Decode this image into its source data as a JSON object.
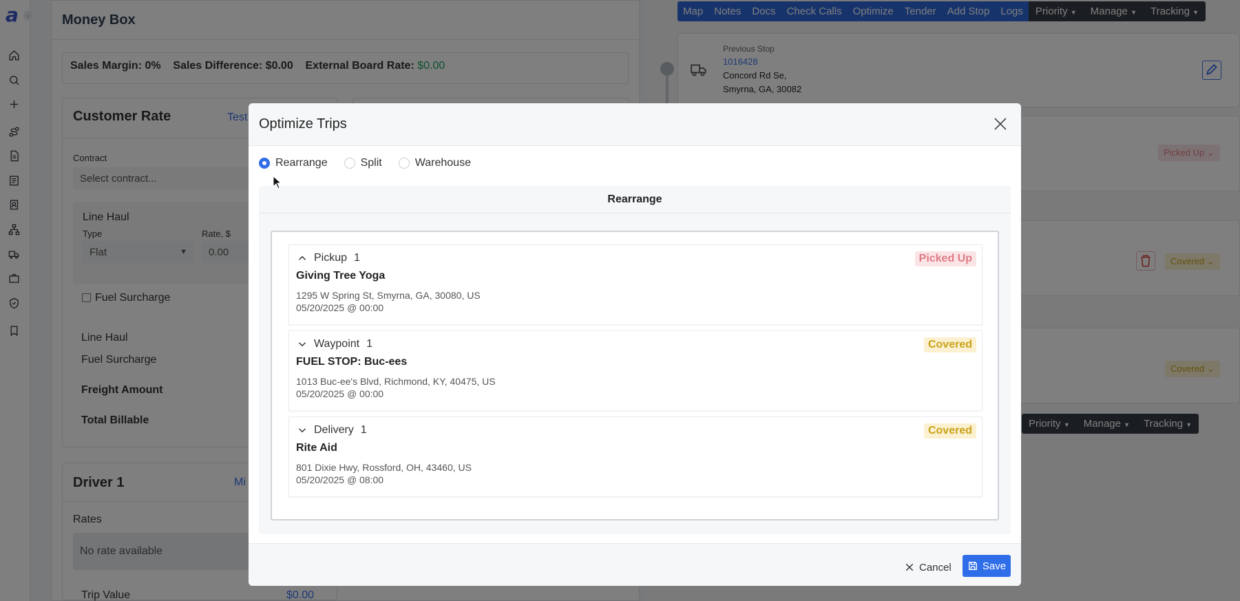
{
  "app": {
    "logo": "a"
  },
  "sidebar": {
    "icons": [
      "home-icon",
      "search-icon",
      "plus-icon",
      "route-icon",
      "document-icon",
      "list-icon",
      "contact-icon",
      "org-chart-icon",
      "truck-icon",
      "briefcase-icon",
      "shield-icon",
      "bookmark-icon"
    ]
  },
  "money_box": {
    "title": "Money Box",
    "sales_margin_label": "Sales Margin: 0%",
    "sales_difference_label": "Sales Difference: $0.00",
    "external_board_rate_label": "External Board Rate:",
    "external_board_rate_value": "$0.00"
  },
  "customer_rate": {
    "title": "Customer Rate",
    "link": "Test",
    "contract_label": "Contract",
    "contract_placeholder": "Select contract...",
    "line_haul_heading": "Line Haul",
    "type_label": "Type",
    "type_value": "Flat",
    "rate_label": "Rate, $",
    "rate_value": "0.00",
    "fuel_surcharge_checkbox": "Fuel Surcharge",
    "summary": [
      "Line Haul",
      "Fuel Surcharge",
      "Freight Amount",
      "Total Billable"
    ]
  },
  "driver": {
    "title": "Driver 1",
    "link": "Mi",
    "rates_label": "Rates",
    "no_rate": "No rate available",
    "trip_value_label": "Trip Value",
    "trip_value": "$0.00"
  },
  "topnav": {
    "buttons": [
      "Map",
      "Notes",
      "Docs",
      "Check Calls",
      "Optimize",
      "Tender",
      "Add Stop",
      "Logs"
    ],
    "dropdowns": [
      "Priority",
      "Manage",
      "Tracking"
    ]
  },
  "previous_stop": {
    "label": "Previous Stop",
    "id": "1016428",
    "line1": "Concord Rd Se,",
    "line2": "Smyrna, GA, 30082"
  },
  "right_badges": {
    "picked_up": "Picked Up",
    "covered": "Covered"
  },
  "modal": {
    "title": "Optimize Trips",
    "options": [
      {
        "label": "Rearrange",
        "selected": true
      },
      {
        "label": "Split",
        "selected": false
      },
      {
        "label": "Warehouse",
        "selected": false
      }
    ],
    "section_title": "Rearrange",
    "stops": [
      {
        "type": "Pickup",
        "num": "1",
        "expanded": true,
        "name": "Giving Tree Yoga",
        "address": "1295 W Spring St, Smyrna, GA, 30080, US",
        "datetime": "05/20/2025 @ 00:00",
        "status": "Picked Up"
      },
      {
        "type": "Waypoint",
        "num": "1",
        "expanded": false,
        "name": "FUEL STOP: Buc-ees",
        "address": "1013 Buc-ee's Blvd, Richmond, KY, 40475, US",
        "datetime": "05/20/2025 @ 00:00",
        "status": "Covered"
      },
      {
        "type": "Delivery",
        "num": "1",
        "expanded": false,
        "name": "Rite Aid",
        "address": "801 Dixie Hwy, Rossford, OH, 43460, US",
        "datetime": "05/20/2025 @ 08:00",
        "status": "Covered"
      }
    ],
    "cancel_label": "Cancel",
    "save_label": "Save"
  },
  "colors": {
    "primary": "#2f6ee8",
    "nav_dark": "#353b42",
    "picked_up_bg": "#fbe4e6",
    "picked_up_text": "#e07c86",
    "covered_bg": "#fbf1d0",
    "covered_text": "#c9a21a",
    "green": "#20a060"
  }
}
